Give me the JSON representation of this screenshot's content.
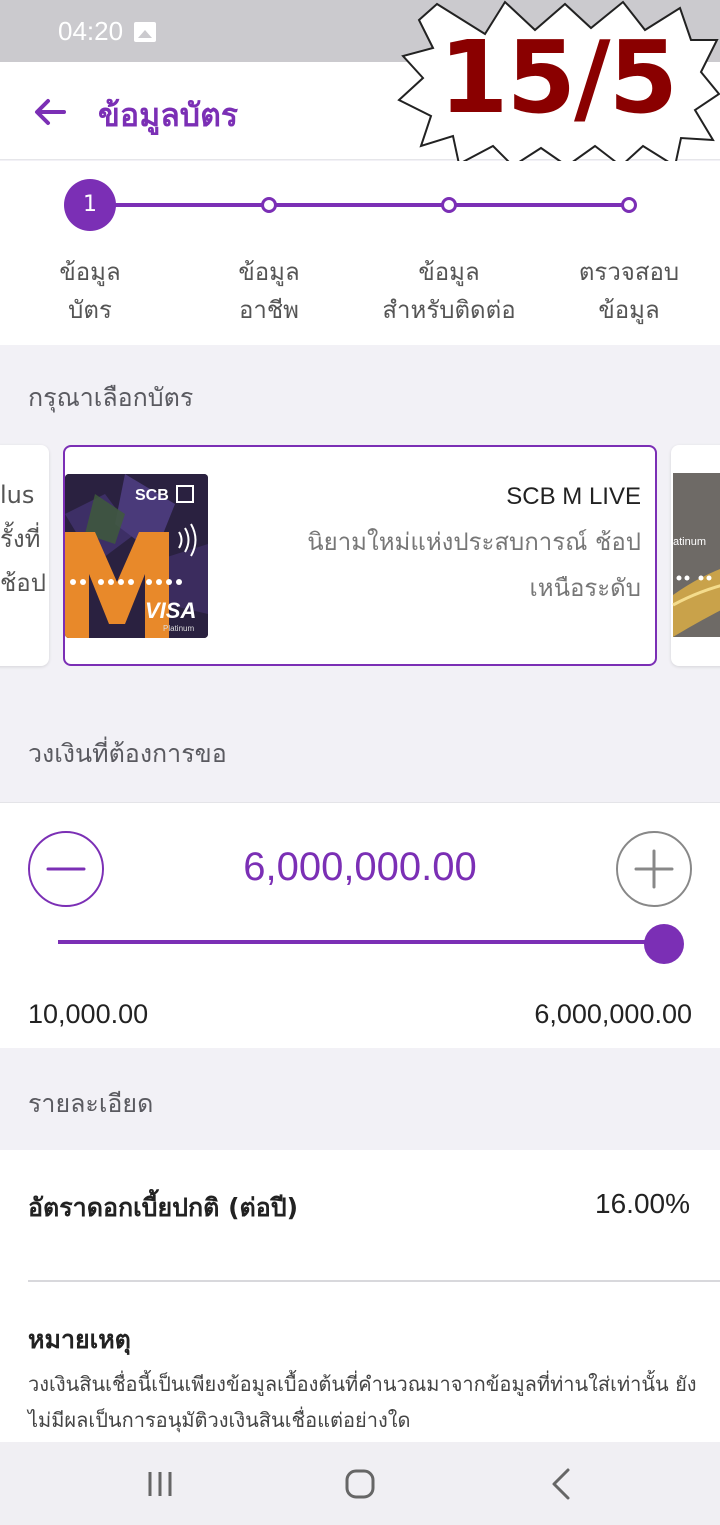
{
  "status_bar": {
    "time": "04:20",
    "icon": "image-icon"
  },
  "header": {
    "title": "ข้อมูลบัตร",
    "back_icon": "arrow-left-icon"
  },
  "overlay": {
    "text": "15/5",
    "shape": "starburst",
    "color": "#8a0000"
  },
  "stepper": {
    "active_step": "1",
    "steps": [
      {
        "line1": "ข้อมูล",
        "line2": "บัตร"
      },
      {
        "line1": "ข้อมูล",
        "line2": "อาชีพ"
      },
      {
        "line1": "ข้อมูล",
        "line2": "สำหรับติดต่อ"
      },
      {
        "line1": "ตรวจสอบ",
        "line2": "ข้อมูล"
      }
    ]
  },
  "card_section": {
    "label": "กรุณาเลือกบัตร",
    "left_card_partial": [
      "lus",
      "รั้งที่",
      "ช้อป"
    ],
    "selected_card": {
      "name": "SCB M LIVE",
      "desc_line1": "นิยามใหม่แห่งประสบการณ์ ช้อป",
      "desc_line2": "เหนือระดับ",
      "brand": "SCB",
      "network": "VISA",
      "tier": "Platinum"
    },
    "right_card_partial_tier": "atinum"
  },
  "amount_section": {
    "label": "วงเงินที่ต้องการขอ",
    "value": "6,000,000.00",
    "min": "10,000.00",
    "max": "6,000,000.00",
    "slider_fraction": 1.0
  },
  "details": {
    "label": "รายละเอียด",
    "rate_label": "อัตราดอกเบี้ยปกติ (ต่อปี)",
    "rate_value": "16.00%",
    "note_title": "หมายเหตุ",
    "note_line1": "วงเงินสินเชื่อนี้เป็นเพียงข้อมูลเบื้องต้นที่คำนวณมาจากข้อมูลที่ท่านใส่เท่านั้น ยัง",
    "note_line2": "ไม่มีผลเป็นการอนุมัติวงเงินสินเชื่อแต่อย่างใด"
  },
  "nav": {
    "recent": "recent-apps-icon",
    "home": "home-icon",
    "back": "back-icon"
  },
  "colors": {
    "accent": "#7b2fb5",
    "background": "#f2f1f6"
  }
}
